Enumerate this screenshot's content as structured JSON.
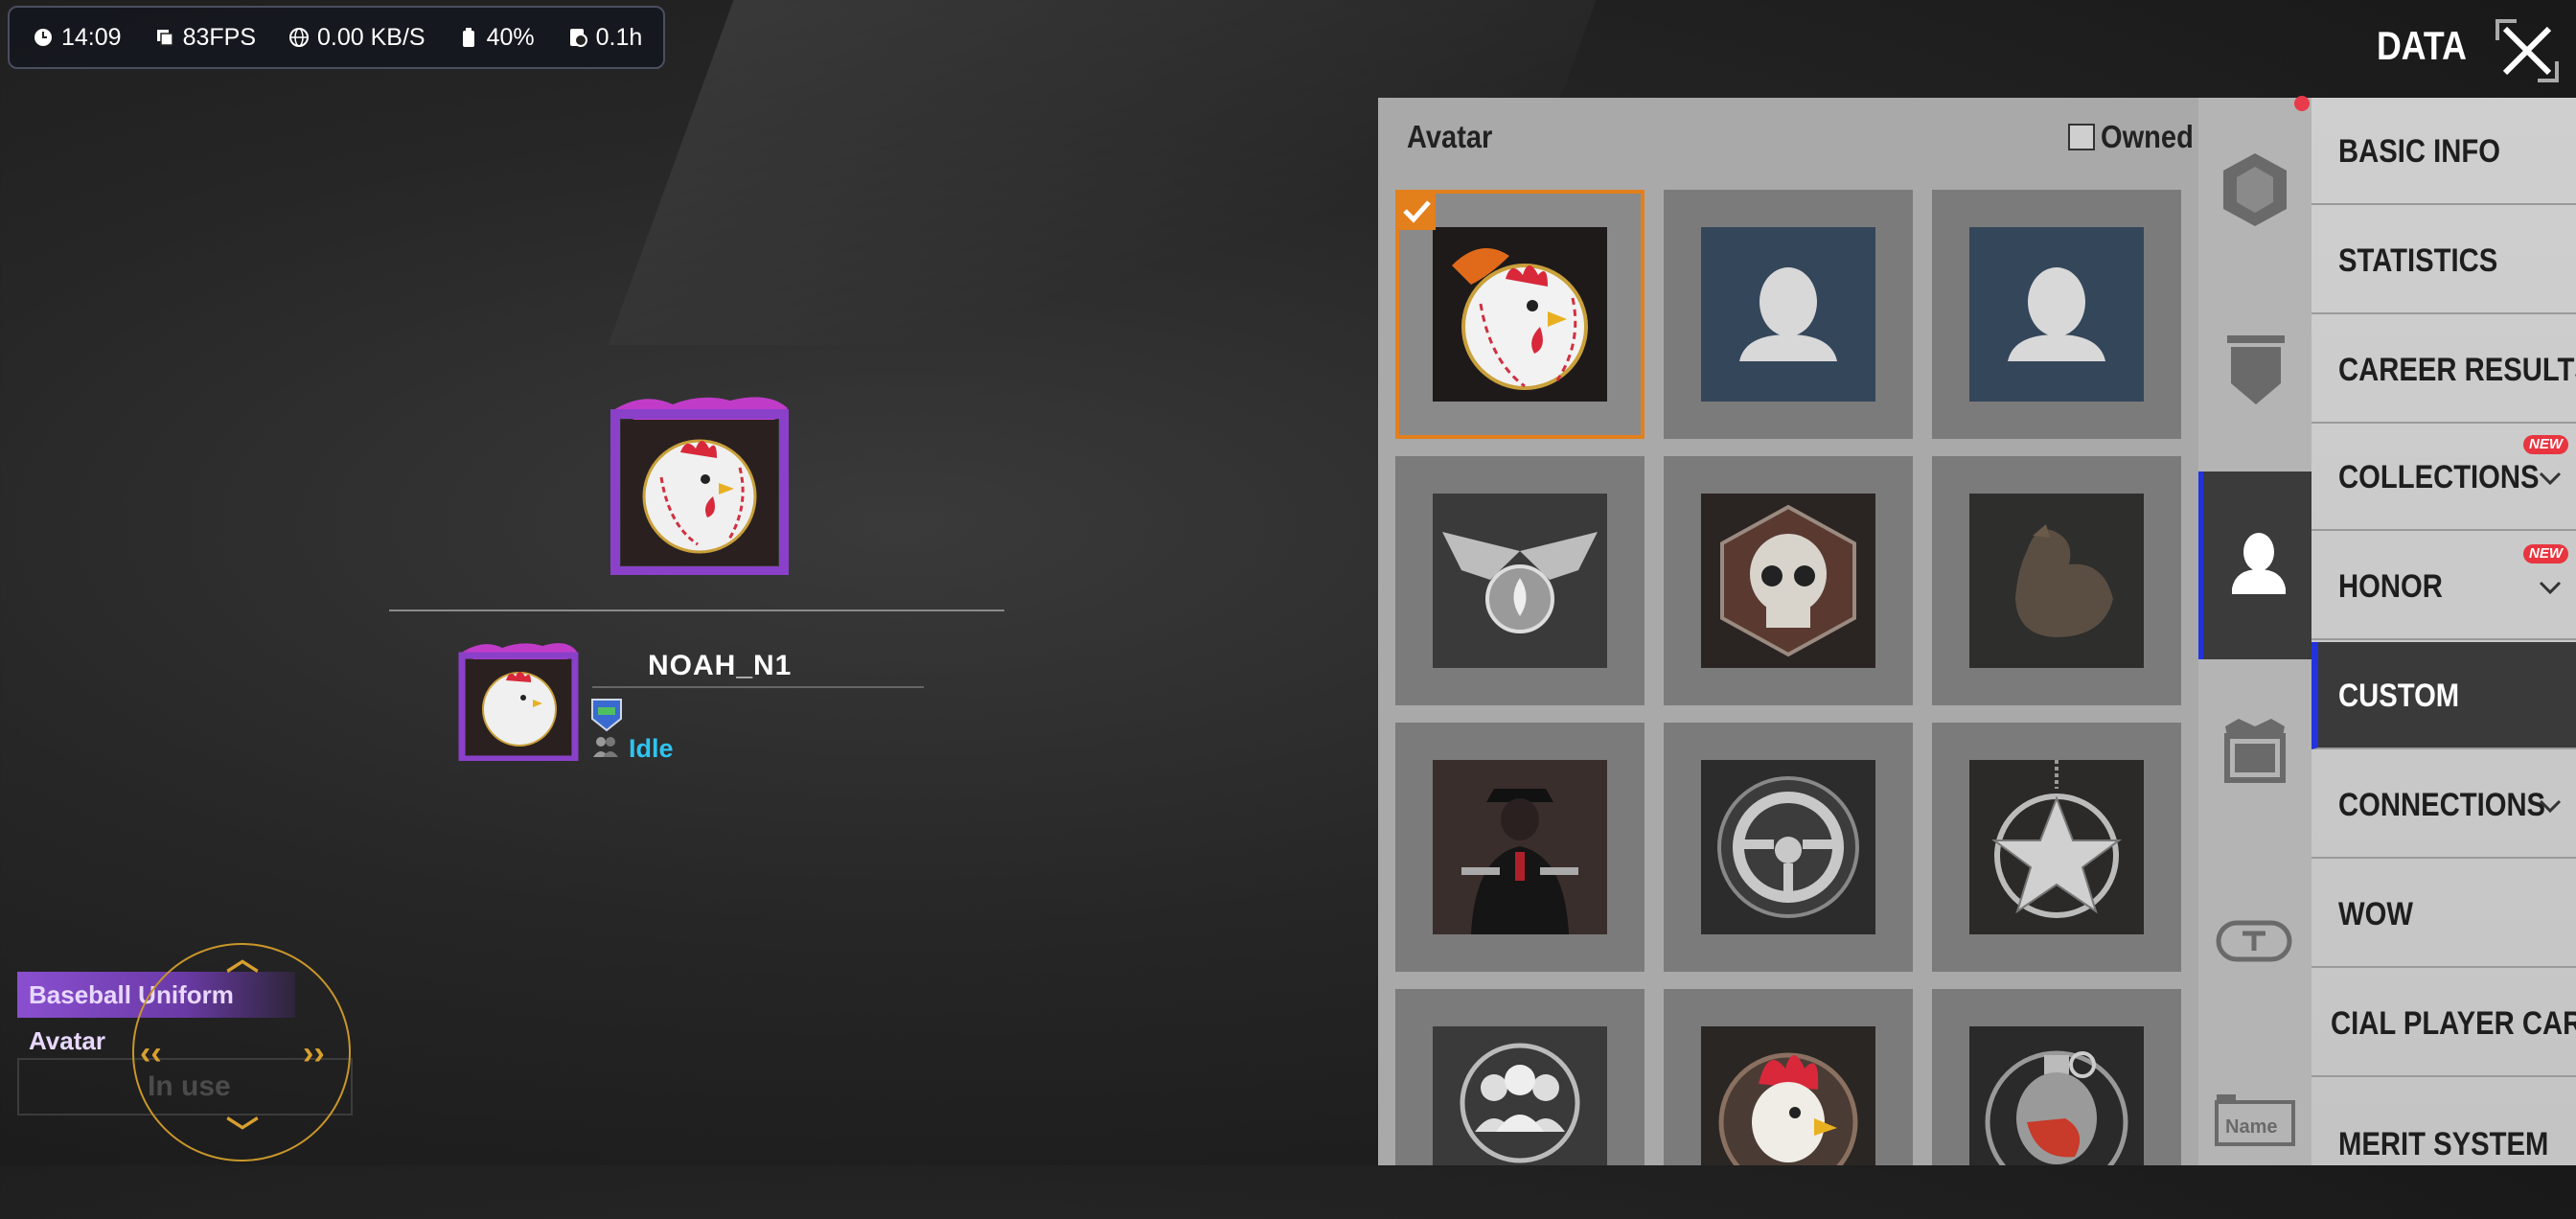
{
  "status_bar": {
    "time": "14:09",
    "fps": "83FPS",
    "network": "0.00 KB/S",
    "battery": "40%",
    "session": "0.1h"
  },
  "header": {
    "title": "DATA",
    "close_icon": "close-icon"
  },
  "profile": {
    "player_name": "NOAH_N1",
    "status": "Idle",
    "avatar_icon": "rooster-baseball-icon"
  },
  "selected_item": {
    "name": "Baseball Uniform Avatar",
    "state": "In use"
  },
  "panel": {
    "title": "Avatar",
    "owned_label": "Owned",
    "avatars": [
      {
        "icon": "rooster-baseball-icon",
        "selected": true
      },
      {
        "icon": "default-avatar-icon"
      },
      {
        "icon": "default-avatar-icon"
      },
      {
        "icon": "winged-emblem-icon"
      },
      {
        "icon": "skull-icon"
      },
      {
        "icon": "chicken-silhouette-icon"
      },
      {
        "icon": "gunman-icon"
      },
      {
        "icon": "steering-wheel-icon"
      },
      {
        "icon": "star-pendant-icon"
      },
      {
        "icon": "squad-icon"
      },
      {
        "icon": "rooster-head-icon"
      },
      {
        "icon": "grenade-icon"
      }
    ]
  },
  "category_rail": [
    {
      "icon": "badge-icon"
    },
    {
      "icon": "shield-icon"
    },
    {
      "icon": "avatar-icon",
      "active": true
    },
    {
      "icon": "frame-icon"
    },
    {
      "icon": "title-icon"
    },
    {
      "icon": "nameplate-icon"
    }
  ],
  "menu": {
    "items": [
      {
        "label": "BASIC INFO"
      },
      {
        "label": "STATISTICS"
      },
      {
        "label": "CAREER RESULTS"
      },
      {
        "label": "COLLECTIONS",
        "badge": "NEW",
        "expandable": true
      },
      {
        "label": "HONOR",
        "badge": "NEW",
        "expandable": true
      },
      {
        "label": "CUSTOM",
        "active": true
      },
      {
        "label": "CONNECTIONS",
        "expandable": true
      },
      {
        "label": "WOW"
      },
      {
        "label": "CIAL PLAYER CARD"
      },
      {
        "label": "MERIT SYSTEM"
      }
    ]
  },
  "colors": {
    "accent_blue": "#2233dd",
    "selection_orange": "#e3801c",
    "idle_cyan": "#2fc4f0",
    "new_badge": "#e8353f"
  }
}
